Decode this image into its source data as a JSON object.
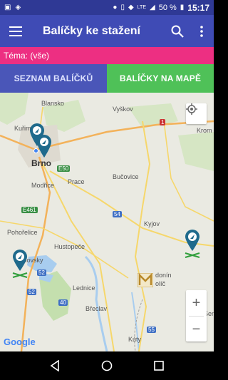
{
  "status_bar": {
    "battery": "50 %",
    "time": "15:17",
    "network": "LTE"
  },
  "app_bar": {
    "title": "Balíčky ke stažení",
    "icons": [
      "menu-icon",
      "search-icon",
      "more-vert-icon"
    ]
  },
  "theme": {
    "label": "Téma: (vše)"
  },
  "tabs": [
    {
      "label": "SEZNAM BALÍČKŮ",
      "active": false
    },
    {
      "label": "BALÍČKY NA MAPĚ",
      "active": true
    }
  ],
  "map": {
    "labels": {
      "blansko": "Blansko",
      "vyskov": "Vyškov",
      "kurim": "Kuřim",
      "brno": "Brno",
      "modrice": "Modřice",
      "prace": "Prace",
      "bucovice": "Bučovice",
      "kyjov": "Kyjov",
      "pohorelice": "Pohořelice",
      "hustopece": "Hustopeče",
      "pavlovsky": "Pavlovsky",
      "lednice": "Lednice",
      "breclav": "Břeclav",
      "kuty": "Kúty",
      "kromeriz": "Krom",
      "hodonin": "donín",
      "holic": "olíč",
      "senica": "Senica"
    },
    "road_shields": {
      "d1": "1",
      "e50": "E50",
      "e461": "E461",
      "r52": "52",
      "r54": "54",
      "r55": "55",
      "r40": "40",
      "r52b": "52"
    },
    "zoom_in": "+",
    "zoom_out": "−",
    "attribution": "Google",
    "colors": {
      "water": "#a8cdef",
      "park": "#c4dfae",
      "marker": "#1f6a8c",
      "marker_green": "#2f9e3a",
      "road_yellow": "#f6d76b",
      "road_orange": "#f3b25a"
    }
  },
  "nav_bar": {
    "icons": [
      "back-icon",
      "home-icon",
      "recents-icon"
    ]
  }
}
